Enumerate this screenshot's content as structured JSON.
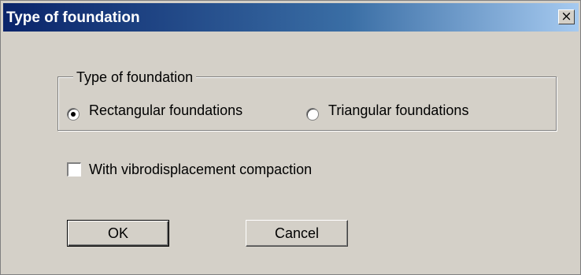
{
  "dialog": {
    "title": "Type of foundation",
    "close_glyph": "×"
  },
  "foundation_group": {
    "legend": "Type of foundation",
    "options": [
      {
        "label": "Rectangular foundations",
        "selected": true
      },
      {
        "label": "Triangular foundations",
        "selected": false
      }
    ]
  },
  "vibro_checkbox": {
    "label": "With vibrodisplacement compaction",
    "checked": false
  },
  "buttons": {
    "ok": "OK",
    "cancel": "Cancel"
  }
}
